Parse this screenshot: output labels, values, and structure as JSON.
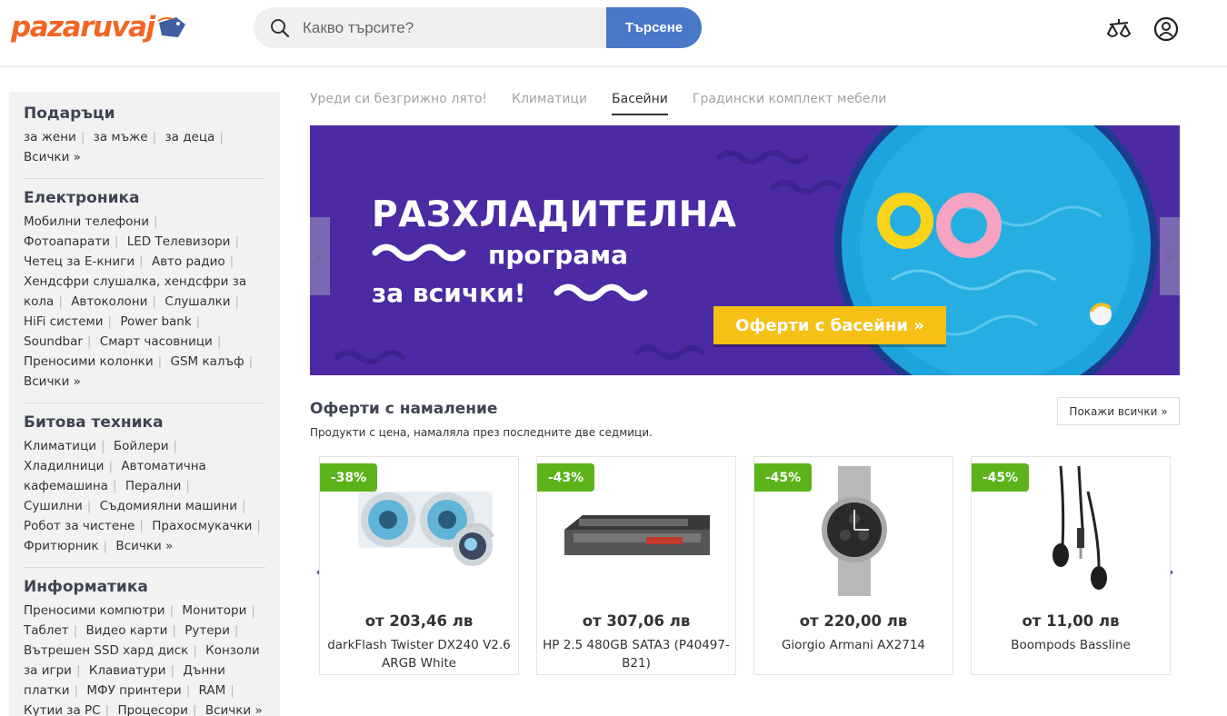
{
  "header": {
    "logo_text": "pazaruvaj",
    "search_placeholder": "Какво търсите?",
    "search_button": "Търсене",
    "icons": [
      "compare-icon",
      "user-account-icon"
    ]
  },
  "sidebar": {
    "categories": [
      {
        "title": "Подаръци",
        "links": [
          "за жени",
          "за мъже",
          "за деца"
        ],
        "all": "Всички »"
      },
      {
        "title": "Електроника",
        "links": [
          "Мобилни телефони",
          "Фотоапарати",
          "LED Телевизори",
          "Четец за Е-книги",
          "Авто радио",
          "Хендсфри слушалка, хендсфри за кола",
          "Автоколони",
          "Слушалки",
          "HiFi системи",
          "Power bank",
          "Soundbar",
          "Смарт часовници",
          "Преносими колонки",
          "GSM калъф"
        ],
        "all": "Всички »"
      },
      {
        "title": "Битова техника",
        "links": [
          "Климатици",
          "Бойлери",
          "Хладилници",
          "Автоматична кафемашина",
          "Перални",
          "Сушилни",
          "Съдомиялни машини",
          "Робот за чистене",
          "Прахосмукачки",
          "Фритюрник"
        ],
        "all": "Всички »"
      },
      {
        "title": "Информатика",
        "links": [
          "Преносими компютри",
          "Монитори",
          "Таблет",
          "Видео карти",
          "Рутери",
          "Вътрешен SSD хард диск",
          "Конзоли за игри",
          "Клавиатури",
          "Дънни платки",
          "МФУ принтери",
          "RAM",
          "Кутии за PC",
          "Процесори"
        ],
        "all": "Всички »"
      }
    ]
  },
  "tabs": [
    {
      "label": "Уреди си безгрижно лято!",
      "active": false
    },
    {
      "label": "Климатици",
      "active": false
    },
    {
      "label": "Басейни",
      "active": true
    },
    {
      "label": "Градински комплект мебели",
      "active": false
    }
  ],
  "banner": {
    "line1": "РАЗХЛАДИТЕЛНА",
    "line2": "програма",
    "line3": "за всички!",
    "cta": "Оферти с басейни  »",
    "prev_arrow": "‹",
    "next_arrow": "›",
    "colors": {
      "background": "#4b2aa3",
      "cta": "#f6c015",
      "pool": "#1ea4dc"
    }
  },
  "deals": {
    "title": "Оферти с намаление",
    "subtitle": "Продукти с цена, намаляла през последните две седмици.",
    "show_all": "Покажи всички »",
    "prev_arrow": "‹",
    "next_arrow": "›",
    "products": [
      {
        "discount": "-38%",
        "price": "от 203,46 лв",
        "name": "darkFlash Twister DX240 V2.6 ARGB White",
        "image": "cpu-cooler"
      },
      {
        "discount": "-43%",
        "price": "от 307,06 лв",
        "name": "HP 2.5 480GB SATA3 (P40497-B21)",
        "image": "ssd-drive"
      },
      {
        "discount": "-45%",
        "price": "от 220,00 лв",
        "name": "Giorgio Armani AX2714",
        "image": "wristwatch"
      },
      {
        "discount": "-45%",
        "price": "от 11,00 лв",
        "name": "Boompods Bassline",
        "image": "earphones"
      }
    ],
    "colors": {
      "badge": "#5bb319"
    }
  }
}
